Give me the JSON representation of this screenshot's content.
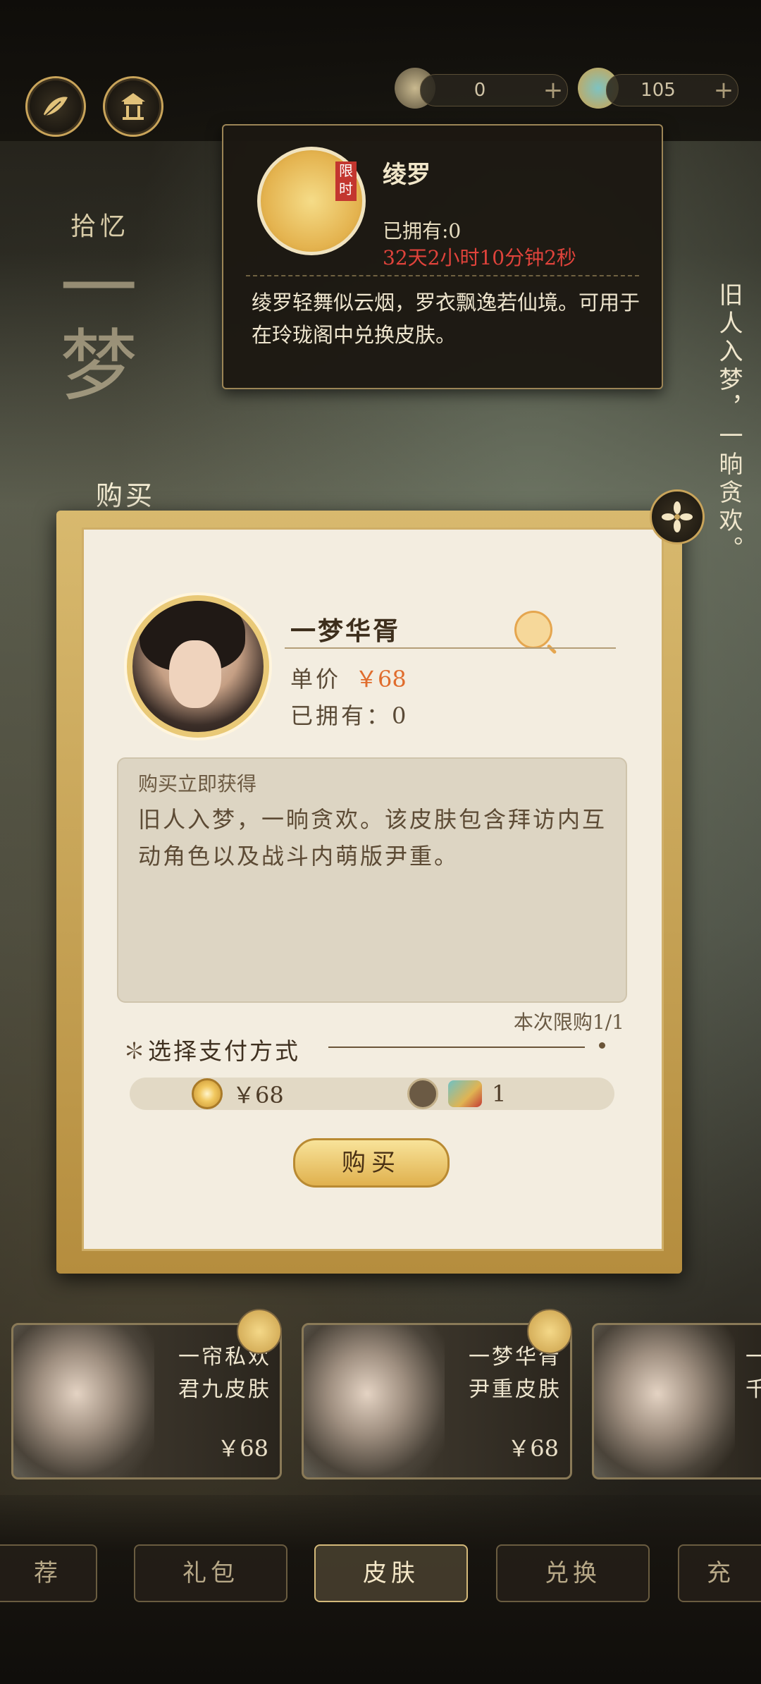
{
  "currency": [
    {
      "value": "0",
      "icon": "flower-coin-icon"
    },
    {
      "value": "105",
      "icon": "silk-icon"
    }
  ],
  "tooltip": {
    "tag": "限时",
    "name": "绫罗",
    "owned": "已拥有:0",
    "timer": "32天2小时10分钟2秒",
    "desc": "绫罗轻舞似云烟，罗衣飘逸若仙境。可用于在玲珑阁中兑换皮肤。"
  },
  "background": {
    "tab_label": "拾忆",
    "big_title": "一梦",
    "side_poem": "旧人入梦，一晌贪欢。"
  },
  "dialog": {
    "title": "购买",
    "product_name": "一梦华胥",
    "price_label": "单价",
    "price_value": "￥68",
    "owned_label": "已拥有：0",
    "gain_title": "购买立即获得",
    "gain_desc": "旧人入梦，一晌贪欢。该皮肤包含拜访内互动角色以及战斗内萌版尹重。",
    "limit": "本次限购1/1",
    "pay_title": "选择支付方式",
    "pay_options": [
      {
        "label": "￥68",
        "selected": true
      },
      {
        "label": "1",
        "selected": false
      }
    ],
    "buy_button": "购买"
  },
  "cards": [
    {
      "line1": "一帘私欢",
      "line2": "君九皮肤",
      "price": "￥68"
    },
    {
      "line1": "一梦华胥",
      "line2": "尹重皮肤",
      "price": "￥68"
    },
    {
      "line1": "一",
      "line2": "千",
      "price": ""
    }
  ],
  "tabs": [
    {
      "label": "荐",
      "active": false
    },
    {
      "label": "礼包",
      "active": false
    },
    {
      "label": "皮肤",
      "active": true
    },
    {
      "label": "兑换",
      "active": false
    },
    {
      "label": "充",
      "active": false
    }
  ],
  "colors": {
    "accent": "#c9a45a",
    "price": "#e06c2c",
    "timer": "#e0433b"
  }
}
